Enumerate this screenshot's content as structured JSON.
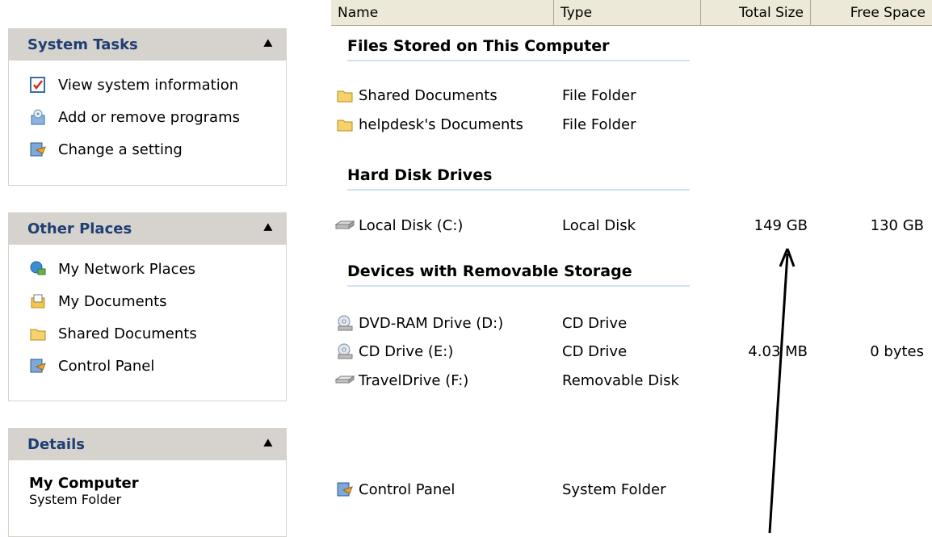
{
  "columns": {
    "name": "Name",
    "type": "Type",
    "total": "Total Size",
    "free": "Free Space"
  },
  "system_tasks": {
    "title": "System Tasks",
    "items": [
      {
        "label": "View system information",
        "icon": "system-info-icon"
      },
      {
        "label": "Add or remove programs",
        "icon": "add-remove-programs-icon"
      },
      {
        "label": "Change a setting",
        "icon": "control-panel-icon"
      }
    ]
  },
  "other_places": {
    "title": "Other Places",
    "items": [
      {
        "label": "My Network Places",
        "icon": "network-places-icon"
      },
      {
        "label": "My Documents",
        "icon": "my-documents-icon"
      },
      {
        "label": "Shared Documents",
        "icon": "folder-icon"
      },
      {
        "label": "Control Panel",
        "icon": "control-panel-icon"
      }
    ]
  },
  "details": {
    "title": "Details",
    "name": "My Computer",
    "kind": "System Folder"
  },
  "groups": {
    "files": "Files Stored on This Computer",
    "hard_disks": "Hard Disk Drives",
    "removable": "Devices with Removable Storage"
  },
  "rows": [
    {
      "name": "Shared Documents",
      "type": "File Folder",
      "total": "",
      "free": "",
      "icon": "folder-icon"
    },
    {
      "name": "helpdesk's Documents",
      "type": "File Folder",
      "total": "",
      "free": "",
      "icon": "folder-icon"
    },
    {
      "name": "Local Disk (C:)",
      "type": "Local Disk",
      "total": "149 GB",
      "free": "130 GB",
      "icon": "hard-disk-icon"
    },
    {
      "name": "DVD-RAM Drive (D:)",
      "type": "CD Drive",
      "total": "",
      "free": "",
      "icon": "cd-drive-icon"
    },
    {
      "name": "CD Drive (E:)",
      "type": "CD Drive",
      "total": "4.03 MB",
      "free": "0 bytes",
      "icon": "cd-drive-icon"
    },
    {
      "name": "TravelDrive (F:)",
      "type": "Removable Disk",
      "total": "",
      "free": "",
      "icon": "removable-disk-icon"
    },
    {
      "name": "Control Panel",
      "type": "System Folder",
      "total": "",
      "free": "",
      "icon": "control-panel-icon"
    }
  ],
  "colors": {
    "pane_header_bg": "#d6d3ce",
    "pane_title": "#1f3e73",
    "group_underline": "#cfe0f7",
    "column_header_bg": "#ece9d8"
  }
}
